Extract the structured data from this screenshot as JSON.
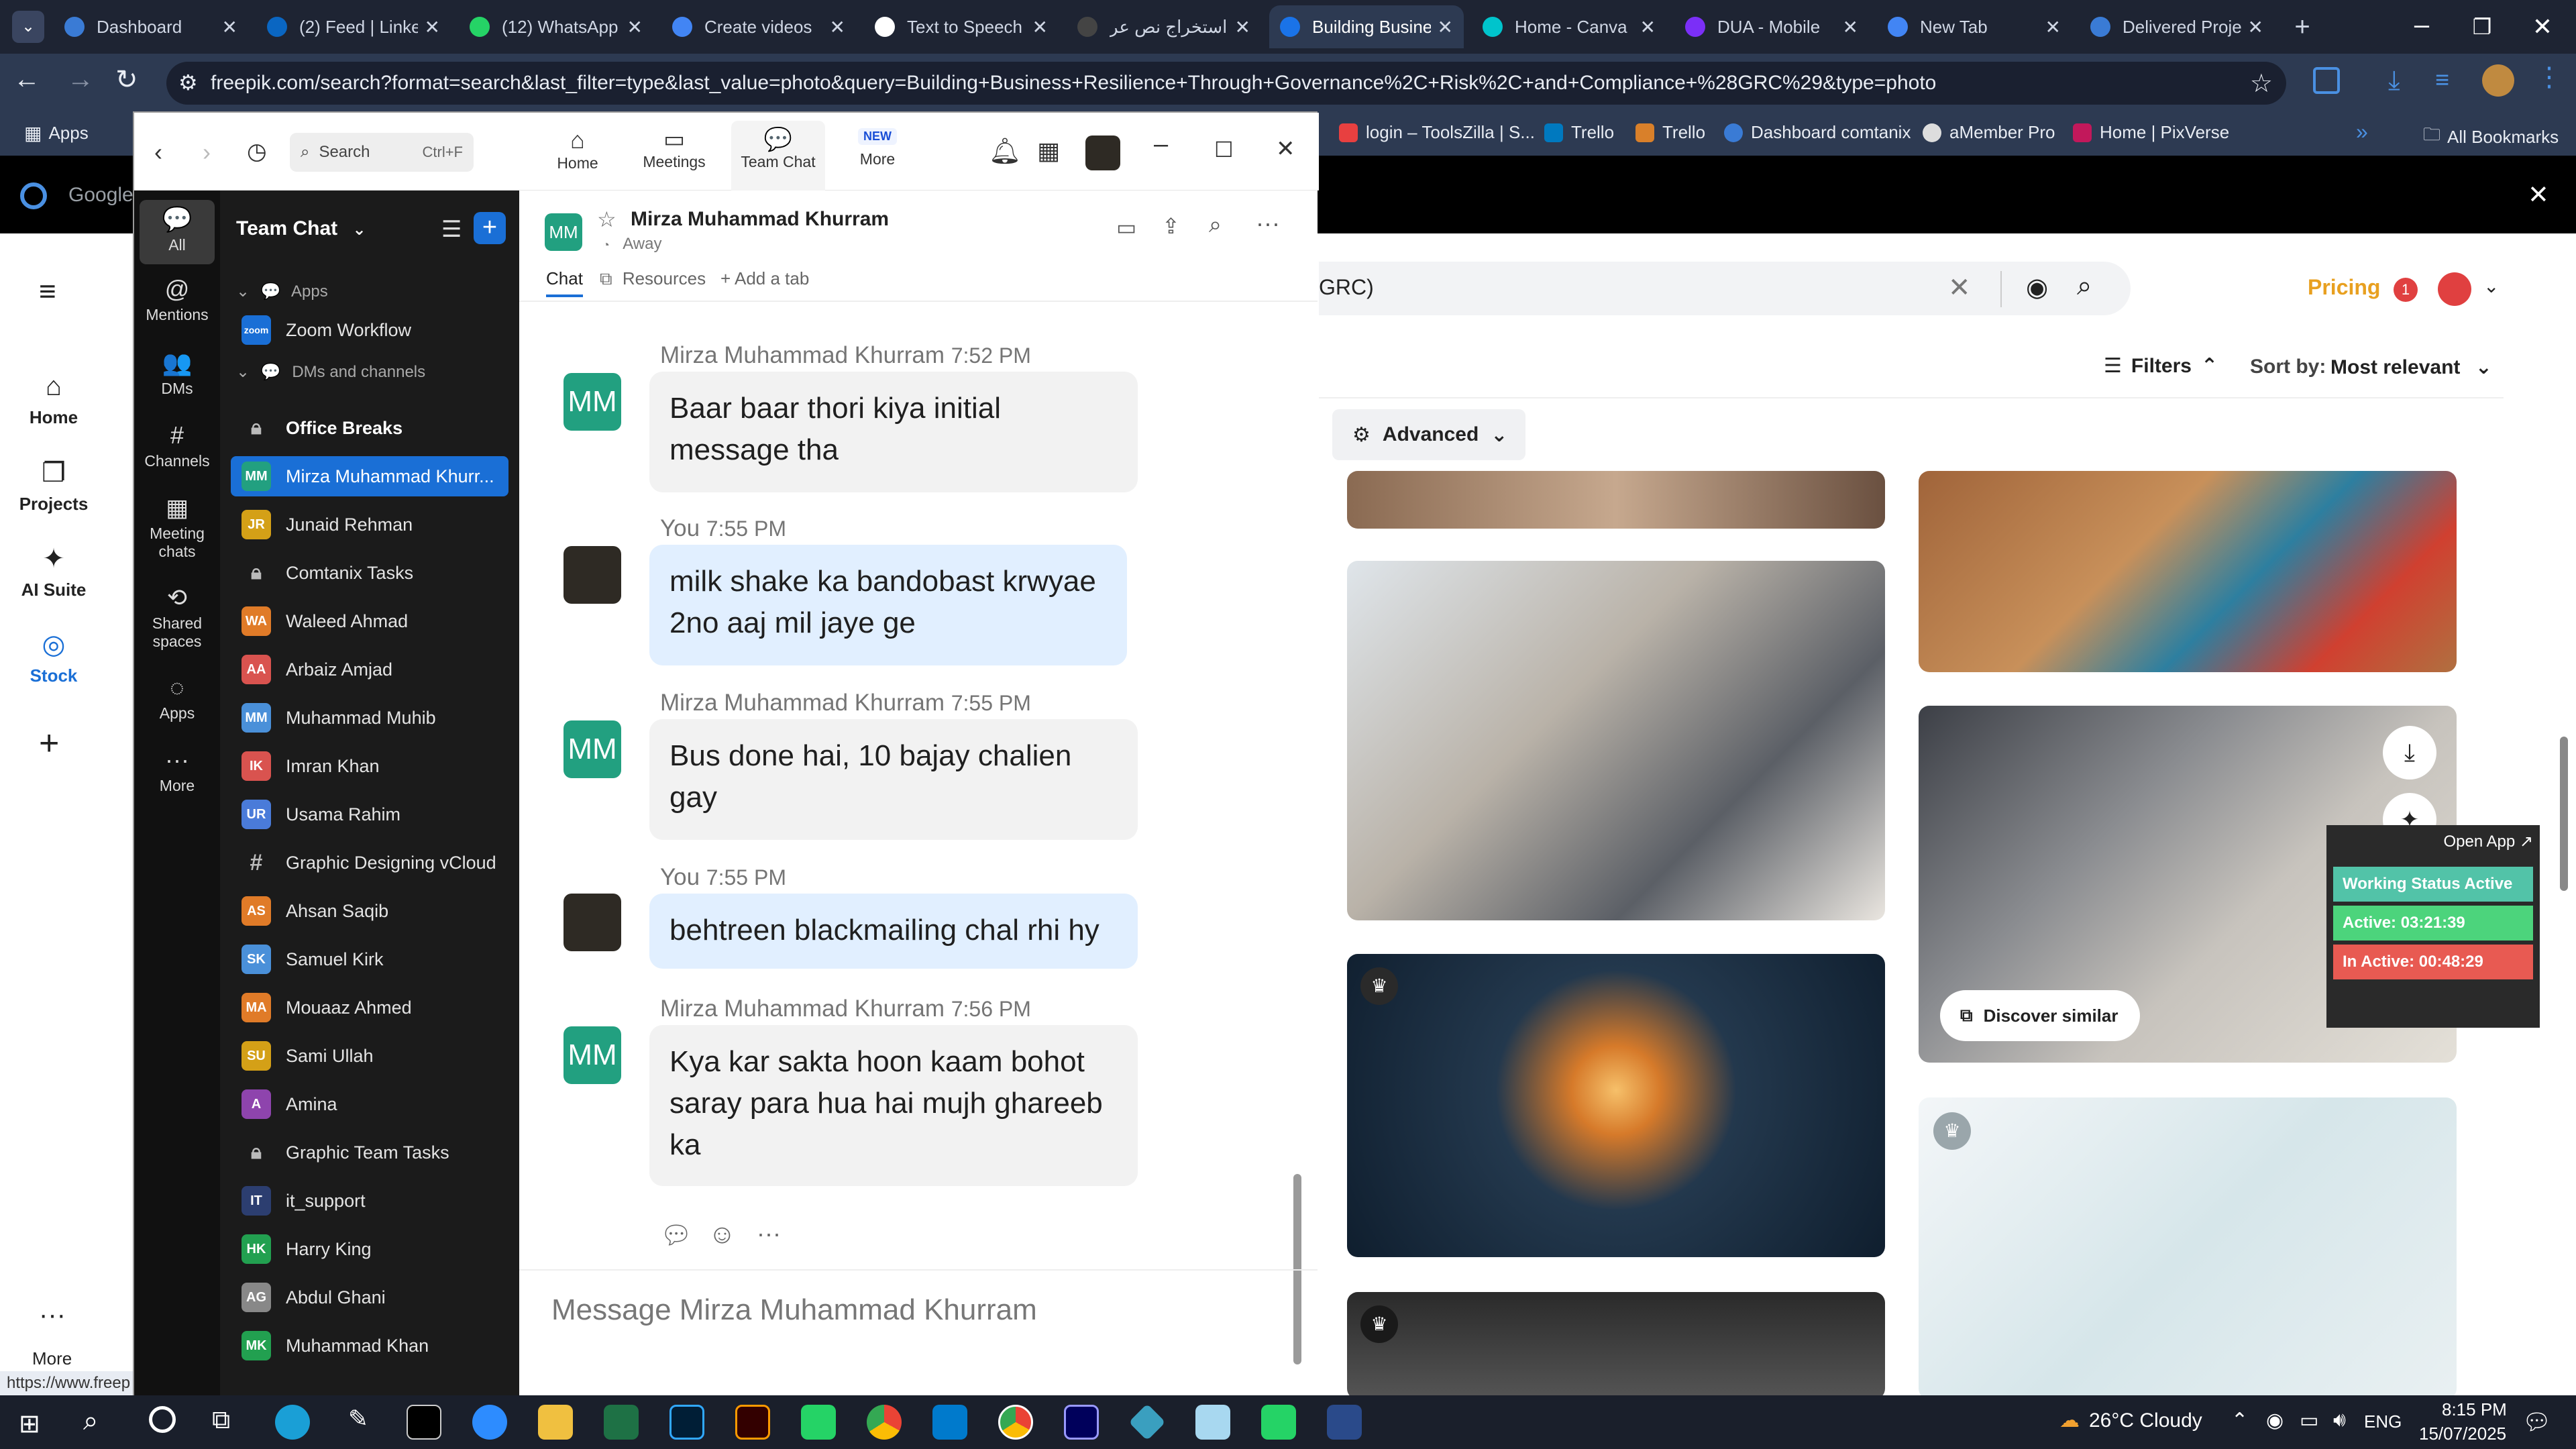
{
  "browser": {
    "tabs": [
      {
        "label": "Dashboard",
        "color": "#3a7bd5"
      },
      {
        "label": "(2) Feed | Linke",
        "color": "#0a66c2"
      },
      {
        "label": "(12) WhatsApp",
        "color": "#25d366"
      },
      {
        "label": "Create videos",
        "color": "#4285f4"
      },
      {
        "label": "Text to Speech",
        "color": "#ffffff"
      },
      {
        "label": "استخراج نص عر",
        "color": "#444444"
      },
      {
        "label": "Building Busine",
        "color": "#1a73e8"
      },
      {
        "label": "Home - Canva",
        "color": "#00c4cc"
      },
      {
        "label": "DUA - Mobile",
        "color": "#7b2ff7"
      },
      {
        "label": "New Tab",
        "color": "#4285f4"
      },
      {
        "label": "Delivered Proje",
        "color": "#3a7bd5"
      }
    ],
    "url": "freepik.com/search?format=search&last_filter=type&last_value=photo&query=Building+Business+Resilience+Through+Governance%2C+Risk%2C+and+Compliance+%28GRC%29&type=photo",
    "bookmarks": {
      "apps": "Apps",
      "items": [
        "login – ToolsZilla | S...",
        "Trello",
        "Trello",
        "Dashboard comtanix",
        "aMember Pro",
        "Home | PixVerse"
      ],
      "all": "All Bookmarks"
    },
    "status_url": "https://www.freep"
  },
  "google_bar": {
    "label": "Google"
  },
  "site_sidebar": {
    "items": [
      {
        "label": "Home",
        "icon": "home-icon",
        "glyph": "⌂"
      },
      {
        "label": "Projects",
        "icon": "projects-icon",
        "glyph": "❐"
      },
      {
        "label": "AI Suite",
        "icon": "ai-suite-icon",
        "glyph": "✦"
      },
      {
        "label": "Stock",
        "icon": "stock-icon",
        "glyph": "◎"
      }
    ],
    "more": "More"
  },
  "zoom": {
    "nav": {
      "search_placeholder": "Search",
      "search_shortcut": "Ctrl+F",
      "tabs": [
        "Home",
        "Meetings",
        "Team Chat",
        "More"
      ],
      "new_badge": "NEW"
    },
    "rail": [
      {
        "label": "All",
        "glyph": "💬"
      },
      {
        "label": "Mentions",
        "glyph": "@"
      },
      {
        "label": "DMs",
        "glyph": "👥"
      },
      {
        "label": "Channels",
        "glyph": "#"
      },
      {
        "label": "Meeting chats",
        "glyph": "▦"
      },
      {
        "label": "Shared spaces",
        "glyph": "⟲"
      },
      {
        "label": "Apps",
        "glyph": "◌"
      },
      {
        "label": "More",
        "glyph": "···"
      }
    ],
    "list": {
      "title": "Team Chat",
      "apps_section": "Apps",
      "zoom_workflow": "Zoom Workflow",
      "dm_section": "DMs and channels",
      "items": [
        {
          "name": "Office Breaks",
          "type": "lock",
          "bold": true
        },
        {
          "name": "Mirza Muhammad Khurr...",
          "type": "avatar",
          "initials": "MM",
          "color": "#22a080",
          "selected": true
        },
        {
          "name": "Junaid Rehman",
          "type": "avatar",
          "initials": "JR",
          "color": "#d4a017"
        },
        {
          "name": "Comtanix Tasks",
          "type": "lock"
        },
        {
          "name": "Waleed Ahmad",
          "type": "avatar",
          "initials": "WA",
          "color": "#e07b28"
        },
        {
          "name": "Arbaiz Amjad",
          "type": "avatar",
          "initials": "AA",
          "color": "#d9534f"
        },
        {
          "name": "Muhammad Muhib",
          "type": "avatar",
          "initials": "MM",
          "color": "#4a90d9"
        },
        {
          "name": "Imran Khan",
          "type": "avatar",
          "initials": "IK",
          "color": "#d9534f"
        },
        {
          "name": "Usama Rahim",
          "type": "avatar",
          "initials": "UR",
          "color": "#4a7bd9"
        },
        {
          "name": "Graphic Designing vCloud",
          "type": "hash"
        },
        {
          "name": "Ahsan Saqib",
          "type": "avatar",
          "initials": "AS",
          "color": "#e07b28"
        },
        {
          "name": "Samuel Kirk",
          "type": "avatar",
          "initials": "SK",
          "color": "#4a90d9"
        },
        {
          "name": "Mouaaz Ahmed",
          "type": "avatar",
          "initials": "MA",
          "color": "#e07b28"
        },
        {
          "name": "Sami Ullah",
          "type": "avatar",
          "initials": "SU",
          "color": "#d4a017"
        },
        {
          "name": "Amina",
          "type": "avatar",
          "initials": "A",
          "color": "#8e44ad"
        },
        {
          "name": "Graphic Team Tasks",
          "type": "lock"
        },
        {
          "name": "it_support",
          "type": "avatar",
          "initials": "IT",
          "color": "#2c3e70"
        },
        {
          "name": "Harry King",
          "type": "avatar",
          "initials": "HK",
          "color": "#22a050"
        },
        {
          "name": "Abdul Ghani",
          "type": "avatar",
          "initials": "AG",
          "color": "#888888"
        },
        {
          "name": "Muhammad Khan",
          "type": "avatar",
          "initials": "MK",
          "color": "#22a050"
        }
      ]
    },
    "chat": {
      "contact": "Mirza Muhammad Khurram",
      "contact_initials": "MM",
      "status": "Away",
      "tabs": [
        "Chat",
        "Resources",
        "+ Add a tab"
      ],
      "messages": [
        {
          "sender": "Mirza Muhammad Khurram",
          "time": "7:52 PM",
          "text": "Baar baar thori kiya initial message tha",
          "mine": false
        },
        {
          "sender": "You",
          "time": "7:55 PM",
          "text": "milk shake ka bandobast krwyae 2no aaj mil jaye ge",
          "mine": true
        },
        {
          "sender": "Mirza Muhammad Khurram",
          "time": "7:55 PM",
          "text": "Bus done hai, 10 bajay chalien gay",
          "mine": false
        },
        {
          "sender": "You",
          "time": "7:55 PM",
          "text": "behtreen blackmailing chal rhi hy",
          "mine": true
        },
        {
          "sender": "Mirza Muhammad Khurram",
          "time": "7:56 PM",
          "text": "Kya kar sakta hoon kaam bohot saray para hua hai mujh ghareeb ka",
          "mine": false
        }
      ],
      "composer_placeholder": "Message Mirza Muhammad Khurram"
    }
  },
  "freepik": {
    "search_fragment": "GRC)",
    "pricing": "Pricing",
    "notif_count": "1",
    "filters": "Filters",
    "sort_label": "Sort by:",
    "sort_value": "Most relevant",
    "advanced": "Advanced",
    "discover": "Discover similar",
    "overlay": {
      "open_app": "Open App ↗",
      "working": "Working Status Active",
      "active": "Active: 03:21:39",
      "inactive": "In Active: 00:48:29"
    }
  },
  "taskbar": {
    "weather": "26°C Cloudy",
    "lang": "ENG",
    "time": "8:15 PM",
    "date": "15/07/2025"
  }
}
